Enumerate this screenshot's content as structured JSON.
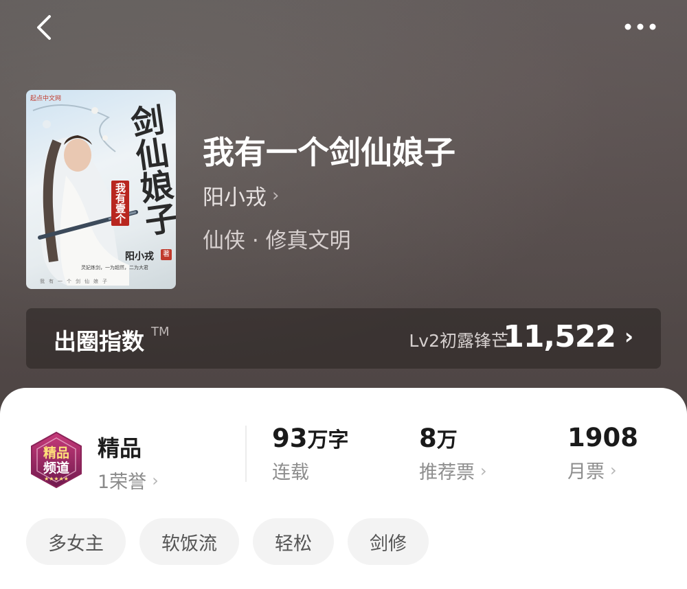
{
  "header": {
    "back_icon": "chevron-left-icon",
    "more_icon": "more-horizontal-icon"
  },
  "book": {
    "title": "我有一个剑仙娘子",
    "author": "阳小戎",
    "genre": "仙侠 · 修真文明",
    "cover": {
      "brand": "起点中文网",
      "title_main": "剑仙娘子",
      "title_sub": "我有壹个",
      "author": "阳小戎",
      "author_badge": "著",
      "tagline": "灵妃炼剑，一为超然，二为大君",
      "bottom_text": "我有一个剑仙娘子"
    }
  },
  "index_bar": {
    "label": "出圈指数",
    "tm": "TM",
    "level": "Lv2初露锋芒",
    "value": "11,522",
    "chevron": "›"
  },
  "stats": {
    "badge_text_top": "精品",
    "badge_text_bottom": "频道",
    "premium_label": "精品",
    "honor": "1荣誉",
    "words_num": "93",
    "words_unit": "万字",
    "words_label": "连载",
    "rec_num": "8",
    "rec_unit": "万",
    "rec_label": "推荐票",
    "month_num": "1908",
    "month_label": "月票"
  },
  "tags": [
    "多女主",
    "软饭流",
    "轻松",
    "剑修"
  ],
  "colors": {
    "hero_bg": "#564e4d",
    "panel_bg": "#ffffff",
    "tag_bg": "#f3f3f3",
    "accent_red": "#b8261f"
  }
}
